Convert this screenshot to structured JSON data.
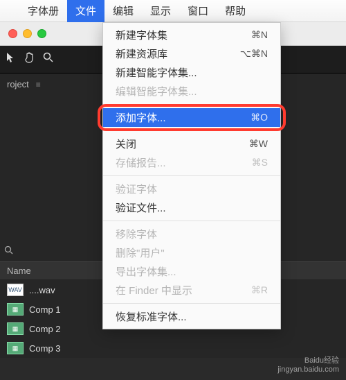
{
  "menubar": {
    "app_title": "字体册",
    "items": [
      "文件",
      "编辑",
      "显示",
      "窗口",
      "帮助"
    ]
  },
  "dropdown": {
    "items": [
      {
        "label": "新建字体集",
        "shortcut": "⌘N",
        "disabled": false
      },
      {
        "label": "新建资源库",
        "shortcut": "⌥⌘N",
        "disabled": false
      },
      {
        "label": "新建智能字体集...",
        "shortcut": "",
        "disabled": false
      },
      {
        "label": "编辑智能字体集...",
        "shortcut": "",
        "disabled": true
      },
      {
        "sep": true
      },
      {
        "label": "添加字体...",
        "shortcut": "⌘O",
        "disabled": false,
        "highlight": true
      },
      {
        "sep": true
      },
      {
        "label": "关闭",
        "shortcut": "⌘W",
        "disabled": false
      },
      {
        "label": "存储报告...",
        "shortcut": "⌘S",
        "disabled": true
      },
      {
        "sep": true
      },
      {
        "label": "验证字体",
        "shortcut": "",
        "disabled": true
      },
      {
        "label": "验证文件...",
        "shortcut": "",
        "disabled": false
      },
      {
        "sep": true
      },
      {
        "label": "移除字体",
        "shortcut": "",
        "disabled": true
      },
      {
        "label": "删除\"用户\"",
        "shortcut": "",
        "disabled": true
      },
      {
        "label": "导出字体集...",
        "shortcut": "",
        "disabled": true
      },
      {
        "label": "在 Finder 中显示",
        "shortcut": "⌘R",
        "disabled": true
      },
      {
        "sep": true
      },
      {
        "label": "恢复标准字体...",
        "shortcut": "",
        "disabled": false
      }
    ]
  },
  "panel": {
    "project_label": "roject"
  },
  "list": {
    "header": "Name",
    "rows": [
      {
        "name": "....wav",
        "type": "wav"
      },
      {
        "name": "Comp 1",
        "type": "comp"
      },
      {
        "name": "Comp 2",
        "type": "comp"
      },
      {
        "name": "Comp 3",
        "type": "comp"
      }
    ]
  },
  "watermark": {
    "line1": "Baidu经验",
    "line2": "jingyan.baidu.com"
  }
}
